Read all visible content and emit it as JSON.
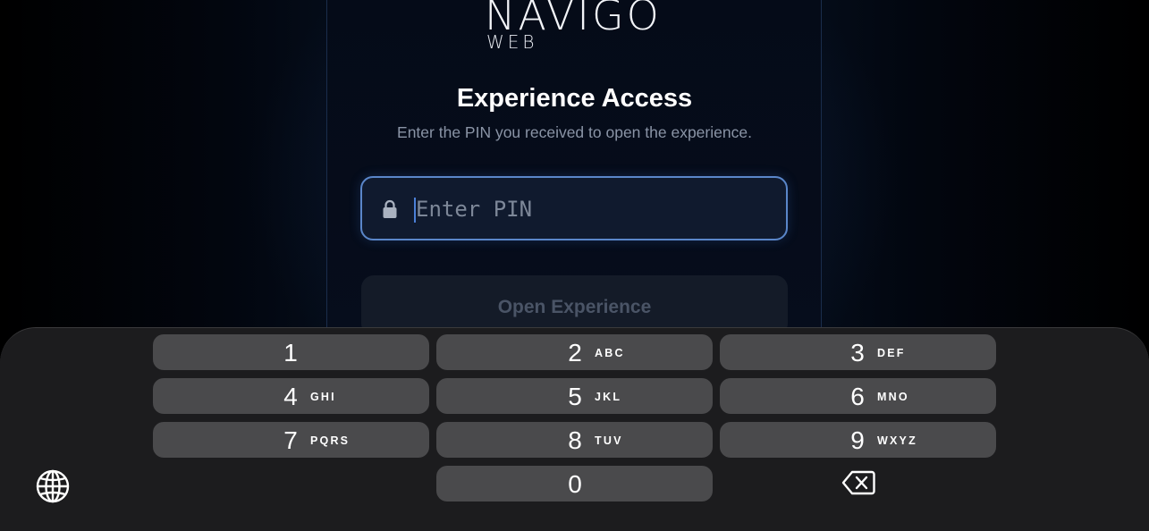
{
  "brand": {
    "name": "NAVIGO",
    "sub": "WEB"
  },
  "heading": {
    "title": "Experience Access",
    "subtitle": "Enter the PIN you received to open the experience."
  },
  "pin_field": {
    "placeholder": "Enter PIN",
    "value": ""
  },
  "submit": {
    "label": "Open Experience"
  },
  "keypad": {
    "keys": [
      {
        "digit": "1",
        "letters": ""
      },
      {
        "digit": "2",
        "letters": "ABC"
      },
      {
        "digit": "3",
        "letters": "DEF"
      },
      {
        "digit": "4",
        "letters": "GHI"
      },
      {
        "digit": "5",
        "letters": "JKL"
      },
      {
        "digit": "6",
        "letters": "MNO"
      },
      {
        "digit": "7",
        "letters": "PQRS"
      },
      {
        "digit": "8",
        "letters": "TUV"
      },
      {
        "digit": "9",
        "letters": "WXYZ"
      },
      {
        "digit": "0",
        "letters": ""
      }
    ],
    "globe_icon": "globe-icon",
    "delete_icon": "delete-backspace-icon"
  },
  "colors": {
    "accent": "#5a86c9",
    "key_bg": "#4a4a4c",
    "keyboard_bg": "#1c1c1e"
  }
}
